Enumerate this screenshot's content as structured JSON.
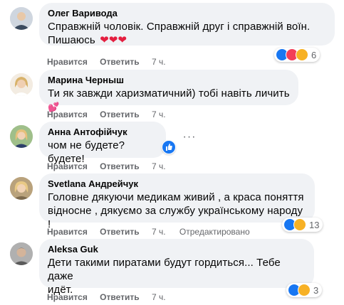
{
  "actions": {
    "like": "Нравится",
    "reply": "Ответить",
    "edited": "Отредактировано"
  },
  "comments": [
    {
      "author": "Олег Варивода",
      "lines": [
        "Справжній чоловік. Справжній друг і справжній воїн.",
        "Пишаюсь"
      ],
      "hearts": "❤❤❤",
      "time": "7 ч.",
      "reactions": "6"
    },
    {
      "author": "Марина Черныш",
      "lines": [
        "Ти як завжди харизматичний) тобі навіть личить"
      ],
      "time": "7 ч."
    },
    {
      "author": "Анна Антофійчук",
      "lines": [
        "чом не будете? будете!"
      ],
      "time": "7 ч."
    },
    {
      "author": "Svetlana Андрейчук",
      "lines": [
        "Головне дякуючи медикам живий , а краса поняття",
        "відносне , дякуємо за службу українському народу !"
      ],
      "time": "7 ч.",
      "reactions": "13"
    },
    {
      "author": "Aleksa Guk",
      "lines": [
        "Дети такими пиратами будут гордиться... Тебе даже",
        "идёт."
      ],
      "time": "7 ч.",
      "reactions": "3"
    }
  ],
  "icons": {
    "like": "thumbs-up-icon",
    "love": "heart-icon",
    "care": "care-icon",
    "more": "more-options-icon"
  },
  "colors": {
    "bubble": "#f0f2f5",
    "meta": "#65676b",
    "like": "#1877f2",
    "heart": "#f33e58",
    "care": "#f7b125"
  }
}
